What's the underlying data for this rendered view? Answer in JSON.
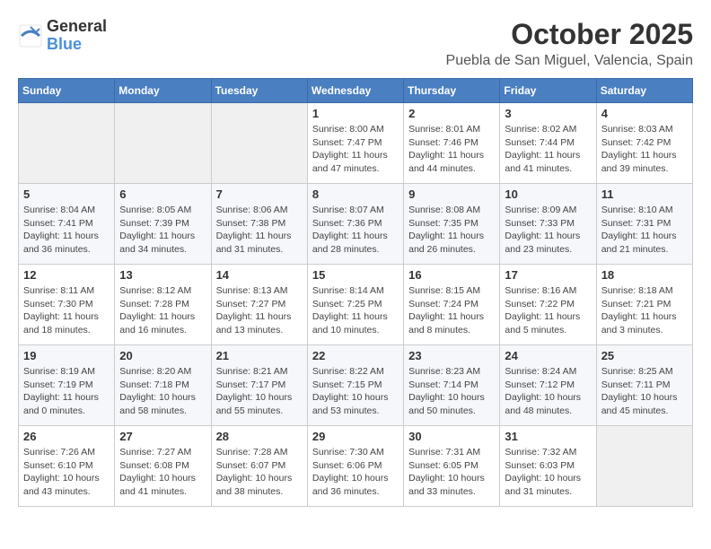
{
  "header": {
    "logo_general": "General",
    "logo_blue": "Blue",
    "month": "October 2025",
    "location": "Puebla de San Miguel, Valencia, Spain"
  },
  "weekdays": [
    "Sunday",
    "Monday",
    "Tuesday",
    "Wednesday",
    "Thursday",
    "Friday",
    "Saturday"
  ],
  "weeks": [
    [
      {
        "day": "",
        "info": ""
      },
      {
        "day": "",
        "info": ""
      },
      {
        "day": "",
        "info": ""
      },
      {
        "day": "1",
        "info": "Sunrise: 8:00 AM\nSunset: 7:47 PM\nDaylight: 11 hours\nand 47 minutes."
      },
      {
        "day": "2",
        "info": "Sunrise: 8:01 AM\nSunset: 7:46 PM\nDaylight: 11 hours\nand 44 minutes."
      },
      {
        "day": "3",
        "info": "Sunrise: 8:02 AM\nSunset: 7:44 PM\nDaylight: 11 hours\nand 41 minutes."
      },
      {
        "day": "4",
        "info": "Sunrise: 8:03 AM\nSunset: 7:42 PM\nDaylight: 11 hours\nand 39 minutes."
      }
    ],
    [
      {
        "day": "5",
        "info": "Sunrise: 8:04 AM\nSunset: 7:41 PM\nDaylight: 11 hours\nand 36 minutes."
      },
      {
        "day": "6",
        "info": "Sunrise: 8:05 AM\nSunset: 7:39 PM\nDaylight: 11 hours\nand 34 minutes."
      },
      {
        "day": "7",
        "info": "Sunrise: 8:06 AM\nSunset: 7:38 PM\nDaylight: 11 hours\nand 31 minutes."
      },
      {
        "day": "8",
        "info": "Sunrise: 8:07 AM\nSunset: 7:36 PM\nDaylight: 11 hours\nand 28 minutes."
      },
      {
        "day": "9",
        "info": "Sunrise: 8:08 AM\nSunset: 7:35 PM\nDaylight: 11 hours\nand 26 minutes."
      },
      {
        "day": "10",
        "info": "Sunrise: 8:09 AM\nSunset: 7:33 PM\nDaylight: 11 hours\nand 23 minutes."
      },
      {
        "day": "11",
        "info": "Sunrise: 8:10 AM\nSunset: 7:31 PM\nDaylight: 11 hours\nand 21 minutes."
      }
    ],
    [
      {
        "day": "12",
        "info": "Sunrise: 8:11 AM\nSunset: 7:30 PM\nDaylight: 11 hours\nand 18 minutes."
      },
      {
        "day": "13",
        "info": "Sunrise: 8:12 AM\nSunset: 7:28 PM\nDaylight: 11 hours\nand 16 minutes."
      },
      {
        "day": "14",
        "info": "Sunrise: 8:13 AM\nSunset: 7:27 PM\nDaylight: 11 hours\nand 13 minutes."
      },
      {
        "day": "15",
        "info": "Sunrise: 8:14 AM\nSunset: 7:25 PM\nDaylight: 11 hours\nand 10 minutes."
      },
      {
        "day": "16",
        "info": "Sunrise: 8:15 AM\nSunset: 7:24 PM\nDaylight: 11 hours\nand 8 minutes."
      },
      {
        "day": "17",
        "info": "Sunrise: 8:16 AM\nSunset: 7:22 PM\nDaylight: 11 hours\nand 5 minutes."
      },
      {
        "day": "18",
        "info": "Sunrise: 8:18 AM\nSunset: 7:21 PM\nDaylight: 11 hours\nand 3 minutes."
      }
    ],
    [
      {
        "day": "19",
        "info": "Sunrise: 8:19 AM\nSunset: 7:19 PM\nDaylight: 11 hours\nand 0 minutes."
      },
      {
        "day": "20",
        "info": "Sunrise: 8:20 AM\nSunset: 7:18 PM\nDaylight: 10 hours\nand 58 minutes."
      },
      {
        "day": "21",
        "info": "Sunrise: 8:21 AM\nSunset: 7:17 PM\nDaylight: 10 hours\nand 55 minutes."
      },
      {
        "day": "22",
        "info": "Sunrise: 8:22 AM\nSunset: 7:15 PM\nDaylight: 10 hours\nand 53 minutes."
      },
      {
        "day": "23",
        "info": "Sunrise: 8:23 AM\nSunset: 7:14 PM\nDaylight: 10 hours\nand 50 minutes."
      },
      {
        "day": "24",
        "info": "Sunrise: 8:24 AM\nSunset: 7:12 PM\nDaylight: 10 hours\nand 48 minutes."
      },
      {
        "day": "25",
        "info": "Sunrise: 8:25 AM\nSunset: 7:11 PM\nDaylight: 10 hours\nand 45 minutes."
      }
    ],
    [
      {
        "day": "26",
        "info": "Sunrise: 7:26 AM\nSunset: 6:10 PM\nDaylight: 10 hours\nand 43 minutes."
      },
      {
        "day": "27",
        "info": "Sunrise: 7:27 AM\nSunset: 6:08 PM\nDaylight: 10 hours\nand 41 minutes."
      },
      {
        "day": "28",
        "info": "Sunrise: 7:28 AM\nSunset: 6:07 PM\nDaylight: 10 hours\nand 38 minutes."
      },
      {
        "day": "29",
        "info": "Sunrise: 7:30 AM\nSunset: 6:06 PM\nDaylight: 10 hours\nand 36 minutes."
      },
      {
        "day": "30",
        "info": "Sunrise: 7:31 AM\nSunset: 6:05 PM\nDaylight: 10 hours\nand 33 minutes."
      },
      {
        "day": "31",
        "info": "Sunrise: 7:32 AM\nSunset: 6:03 PM\nDaylight: 10 hours\nand 31 minutes."
      },
      {
        "day": "",
        "info": ""
      }
    ]
  ]
}
